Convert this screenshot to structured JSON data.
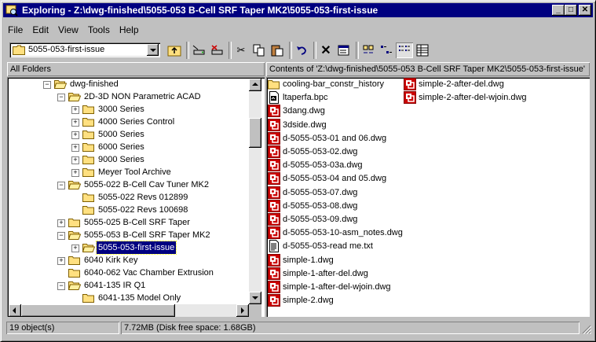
{
  "window": {
    "title": "Exploring - Z:\\dwg-finished\\5055-053 B-Cell SRF Taper MK2\\5055-053-first-issue"
  },
  "title_buttons": {
    "minimize": "_",
    "maximize": "□",
    "close": "✕"
  },
  "menu": [
    "File",
    "Edit",
    "View",
    "Tools",
    "Help"
  ],
  "address": {
    "value": "5055-053-first-issue"
  },
  "toolbar": {
    "buttons": [
      "up-folder",
      "map-drive",
      "disconnect-drive",
      "cut",
      "copy",
      "paste",
      "undo",
      "delete",
      "properties",
      "large-icons",
      "small-icons",
      "list",
      "details"
    ],
    "pressed": "list"
  },
  "left_header": "All Folders",
  "right_header": "Contents of 'Z:\\dwg-finished\\5055-053 B-Cell SRF Taper MK2\\5055-053-first-issue'",
  "tree": [
    {
      "label": "dwg-finished",
      "level": 0,
      "expander": "minus"
    },
    {
      "label": "2D-3D NON Parametric ACAD",
      "level": 1,
      "expander": "minus"
    },
    {
      "label": "3000 Series",
      "level": 2,
      "expander": "plus"
    },
    {
      "label": "4000 Series Control",
      "level": 2,
      "expander": "plus"
    },
    {
      "label": "5000 Series",
      "level": 2,
      "expander": "plus"
    },
    {
      "label": "6000 Series",
      "level": 2,
      "expander": "plus"
    },
    {
      "label": "9000 Series",
      "level": 2,
      "expander": "plus"
    },
    {
      "label": "Meyer Tool Archive",
      "level": 2,
      "expander": "plus"
    },
    {
      "label": "5055-022 B-Cell Cav Tuner MK2",
      "level": 1,
      "expander": "minus"
    },
    {
      "label": "5055-022 Revs 012899",
      "level": 2,
      "expander": "none"
    },
    {
      "label": "5055-022 Revs 100698",
      "level": 2,
      "expander": "none"
    },
    {
      "label": "5055-025 B-Cell SRF Taper",
      "level": 1,
      "expander": "plus"
    },
    {
      "label": "5055-053 B-Cell SRF Taper MK2",
      "level": 1,
      "expander": "minus"
    },
    {
      "label": "5055-053-first-issue",
      "level": 2,
      "expander": "plus",
      "selected": true
    },
    {
      "label": "6040 Kirk Key",
      "level": 1,
      "expander": "plus"
    },
    {
      "label": "6040-062 Vac Chamber Extrusion",
      "level": 1,
      "expander": "none"
    },
    {
      "label": "6041-135 IR Q1",
      "level": 1,
      "expander": "minus"
    },
    {
      "label": "6041-135 Model Only",
      "level": 2,
      "expander": "none"
    }
  ],
  "files_col1": [
    {
      "name": "cooling-bar_constr_history",
      "type": "folder"
    },
    {
      "name": "ltaperfa.bpc",
      "type": "bpc"
    },
    {
      "name": "3dang.dwg",
      "type": "dwg"
    },
    {
      "name": "3dside.dwg",
      "type": "dwg"
    },
    {
      "name": "d-5055-053-01 and 06.dwg",
      "type": "dwg"
    },
    {
      "name": "d-5055-053-02.dwg",
      "type": "dwg"
    },
    {
      "name": "d-5055-053-03a.dwg",
      "type": "dwg"
    },
    {
      "name": "d-5055-053-04 and 05.dwg",
      "type": "dwg"
    },
    {
      "name": "d-5055-053-07.dwg",
      "type": "dwg"
    },
    {
      "name": "d-5055-053-08.dwg",
      "type": "dwg"
    },
    {
      "name": "d-5055-053-09.dwg",
      "type": "dwg"
    },
    {
      "name": "d-5055-053-10-asm_notes.dwg",
      "type": "dwg"
    },
    {
      "name": "d-5055-053-read me.txt",
      "type": "txt"
    },
    {
      "name": "simple-1.dwg",
      "type": "dwg"
    },
    {
      "name": "simple-1-after-del.dwg",
      "type": "dwg"
    },
    {
      "name": "simple-1-after-del-wjoin.dwg",
      "type": "dwg"
    },
    {
      "name": "simple-2.dwg",
      "type": "dwg"
    }
  ],
  "files_col2": [
    {
      "name": "simple-2-after-del.dwg",
      "type": "dwg"
    },
    {
      "name": "simple-2-after-del-wjoin.dwg",
      "type": "dwg"
    }
  ],
  "status": {
    "objects": "19 object(s)",
    "size": "7.72MB (Disk free space: 1.68GB)"
  },
  "colors": {
    "titlebar": "#000080",
    "selection": "#000080",
    "dwg_icon": "#cc0000",
    "folder": "#ffe080"
  }
}
